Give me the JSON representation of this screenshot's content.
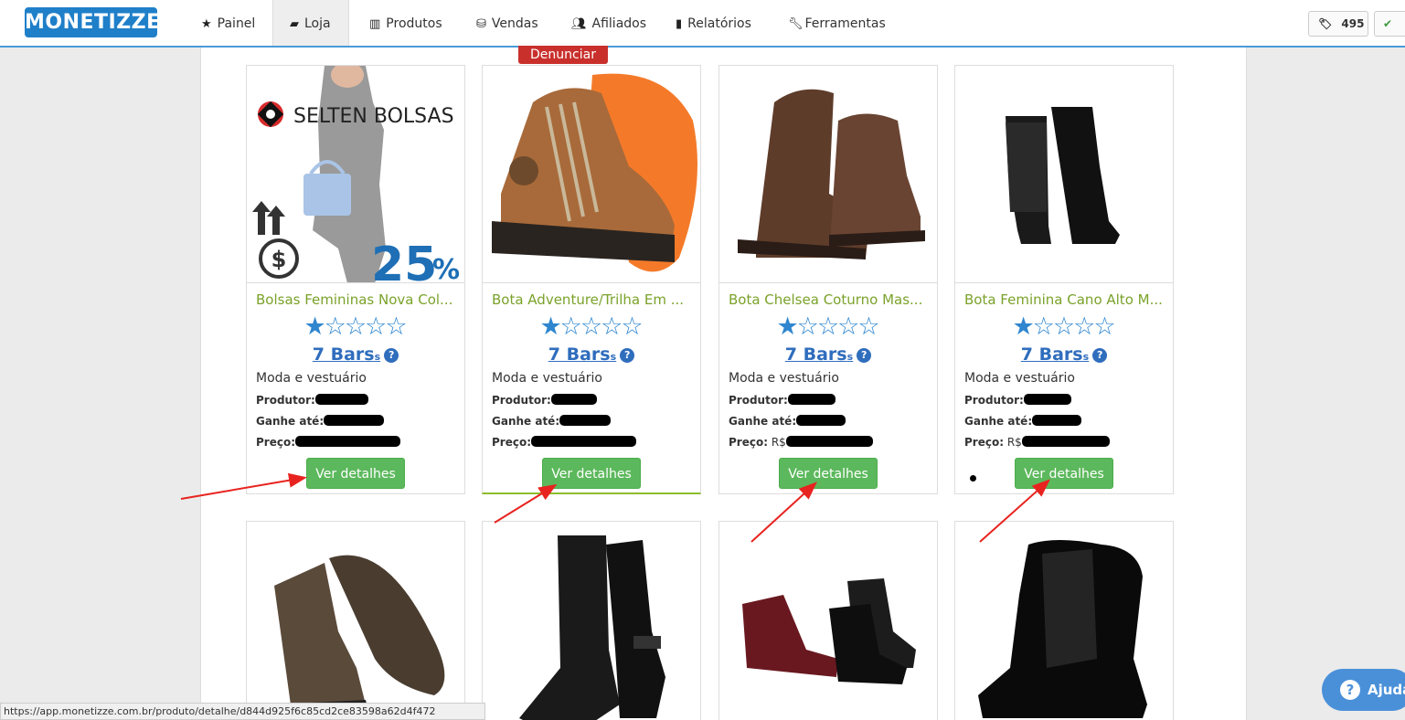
{
  "brand": {
    "logo": "MONETIZZE"
  },
  "nav": [
    {
      "label": "Painel",
      "icon": "star-icon"
    },
    {
      "label": "Loja",
      "icon": "shopping-bag-icon"
    },
    {
      "label": "Produtos",
      "icon": "barcode-icon"
    },
    {
      "label": "Vendas",
      "icon": "money-icon"
    },
    {
      "label": "Afiliados",
      "icon": "users-icon"
    },
    {
      "label": "Relatórios",
      "icon": "bar-chart-icon"
    },
    {
      "label": "Ferramentas",
      "icon": "wrench-icon"
    }
  ],
  "header_right": {
    "tag_count": "495"
  },
  "report_label": "Denunciar",
  "labels": {
    "producer": "Produtor:",
    "earn_up_to": "Ganhe até:",
    "price": "Preço:",
    "details_button": "Ver detalhes"
  },
  "products": [
    {
      "title": "Bolsas Femininas Nova Col...",
      "bars": "7 Bars",
      "category": "Moda e vestuário",
      "price_prefix": ""
    },
    {
      "title": "Bota Adventure/Trilha Em ...",
      "bars": "7 Bars",
      "category": "Moda e vestuário",
      "price_prefix": ""
    },
    {
      "title": "Bota Chelsea Coturno Mas...",
      "bars": "7 Bars",
      "category": "Moda e vestuário",
      "price_prefix": "R$"
    },
    {
      "title": "Bota Feminina Cano Alto M...",
      "bars": "7 Bars",
      "category": "Moda e vestuário",
      "price_prefix": "R$"
    }
  ],
  "rating": {
    "filled": 1,
    "total": 5
  },
  "status_url": "https://app.monetizze.com.br/produto/detalhe/d844d925f6c85cd2ce83598a62d4f472",
  "help": {
    "label": "Ajuda"
  },
  "colors": {
    "brand_blue": "#1f7fc9",
    "green_button": "#5cb85c",
    "title_green": "#7aa22a",
    "arrow_red": "#e8231f"
  }
}
